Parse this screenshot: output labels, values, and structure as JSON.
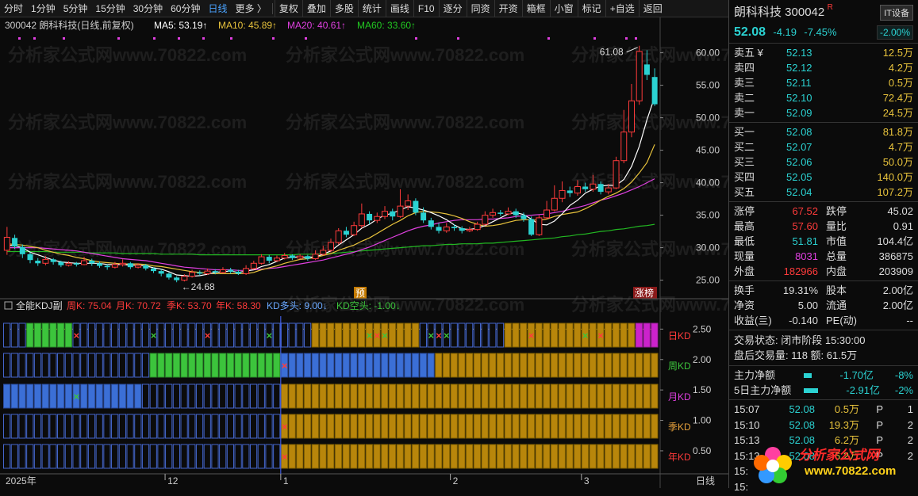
{
  "toolbar": {
    "periods": [
      "分时",
      "1分钟",
      "5分钟",
      "15分钟",
      "30分钟",
      "60分钟",
      "日线",
      "更多 〉"
    ],
    "active_period": "日线",
    "buttons": [
      "复权",
      "叠加",
      "多股",
      "统计",
      "画线",
      "F10",
      "逐分",
      "同资",
      "开资",
      "箱框",
      "小窗",
      "标记",
      "+自选",
      "返回"
    ]
  },
  "chart_header": {
    "stock": "300042 朗科科技(日线,前复权)",
    "ma5": "MA5: 53.19↑",
    "ma10": "MA10: 45.89↑",
    "ma20": "MA20: 40.61↑",
    "ma60": "MA60: 33.60↑"
  },
  "kdj_header": {
    "name": "全能KDJ副",
    "week": "周K: 75.04",
    "month": "月K: 70.72",
    "season": "季K: 53.70",
    "year": "年K: 58.30",
    "kd_long": "KD多头: 9.00↓",
    "kd_short": "KD空头: -1.00↓"
  },
  "kdj_rows": [
    "日KD",
    "周KD",
    "月KD",
    "季KD",
    "年KD"
  ],
  "chart_labels": {
    "high": "61.08",
    "low": "24.68",
    "yu": "预",
    "zhangbang": "涨榜"
  },
  "watermark": "分析家公式网www.70822.com",
  "price_axis": [
    "60.00",
    "55.00",
    "50.00",
    "45.00",
    "40.00",
    "35.00",
    "30.00",
    "25.00"
  ],
  "kdj_axis": [
    "2.50",
    "2.00",
    "1.50",
    "1.00",
    "0.50"
  ],
  "x_axis": {
    "labels": [
      "2025年",
      "12",
      "1",
      "2",
      "3"
    ],
    "period": "日线"
  },
  "colors": {
    "up": "#ff3b3b",
    "down": "#2bd2d2",
    "ma5": "#ffffff",
    "ma10": "#e8c33c",
    "ma20": "#e040e0",
    "ma60": "#22b822",
    "gold": "#b8860b",
    "blue": "#3b6fd6",
    "green": "#3cc43c"
  },
  "quote": {
    "name": "朗科科技 300042",
    "badge_r": "R",
    "sector": "IT设备",
    "price": "52.08",
    "change": "-4.19",
    "pct": "-7.45%",
    "sector_pct": "-2.00%"
  },
  "asks": [
    {
      "l": "卖五 ¥",
      "p": "52.13",
      "v": "12.5万"
    },
    {
      "l": "卖四",
      "p": "52.12",
      "v": "4.2万"
    },
    {
      "l": "卖三",
      "p": "52.11",
      "v": "0.5万"
    },
    {
      "l": "卖二",
      "p": "52.10",
      "v": "72.4万"
    },
    {
      "l": "卖一",
      "p": "52.09",
      "v": "24.5万"
    }
  ],
  "bids": [
    {
      "l": "买一",
      "p": "52.08",
      "v": "81.8万"
    },
    {
      "l": "买二",
      "p": "52.07",
      "v": "4.7万"
    },
    {
      "l": "买三",
      "p": "52.06",
      "v": "50.0万"
    },
    {
      "l": "买四",
      "p": "52.05",
      "v": "140.0万"
    },
    {
      "l": "买五",
      "p": "52.04",
      "v": "107.2万"
    }
  ],
  "stats1": [
    {
      "k": "涨停",
      "v": "67.52",
      "c": "red",
      "k2": "跌停",
      "v2": "45.02",
      "c2": "cyan"
    },
    {
      "k": "最高",
      "v": "57.60",
      "c": "red",
      "k2": "量比",
      "v2": "0.91",
      "c2": "cyan"
    },
    {
      "k": "最低",
      "v": "51.81",
      "c": "cyan",
      "k2": "市值",
      "v2": "104.4亿",
      "c2": "white"
    },
    {
      "k": "现量",
      "v": "8031",
      "c": "mag",
      "k2": "总量",
      "v2": "386875",
      "c2": "white"
    },
    {
      "k": "外盘",
      "v": "182966",
      "c": "red",
      "k2": "内盘",
      "v2": "203909",
      "c2": "cyan"
    }
  ],
  "stats2": [
    {
      "k": "换手",
      "v": "19.31%",
      "c": "white",
      "k2": "股本",
      "v2": "2.00亿",
      "c2": "white"
    },
    {
      "k": "净资",
      "v": "5.00",
      "c": "white",
      "k2": "流通",
      "v2": "2.00亿",
      "c2": "white"
    },
    {
      "k": "收益(亖)",
      "v": "-0.140",
      "c": "white",
      "k2": "PE(动)",
      "v2": "--",
      "c2": "white"
    }
  ],
  "trade": {
    "status": "交易状态: 闭市阶段 15:30:00",
    "after": "盘后交易量: 118  额: 61.5万"
  },
  "flow": [
    {
      "k": "主力净额",
      "v": "-1.70亿",
      "p": "-8%"
    },
    {
      "k": "5日主力净额",
      "v": "-2.91亿",
      "p": "-2%"
    }
  ],
  "ticks": [
    {
      "t": "15:07",
      "p": "52.08",
      "v": "0.5万",
      "s": "P",
      "n": "1"
    },
    {
      "t": "15:10",
      "p": "52.08",
      "v": "19.3万",
      "s": "P",
      "n": "2"
    },
    {
      "t": "15:13",
      "p": "52.08",
      "v": "6.2万",
      "s": "P",
      "n": "2"
    },
    {
      "t": "15:13",
      "p": "52.08",
      "v": "6.2万",
      "s": "P",
      "n": "2"
    },
    {
      "t": "15:",
      "p": "",
      "v": "",
      "s": "",
      "n": ""
    },
    {
      "t": "15:",
      "p": "",
      "v": "",
      "s": "",
      "n": ""
    }
  ],
  "logo": {
    "cn": "分析家公式网",
    "url": "www.70822.com"
  },
  "chart_data": {
    "type": "candlestick",
    "ylim": [
      23,
      63
    ],
    "candles": [
      {
        "o": 29.6,
        "c": 31.6,
        "h": 33.2,
        "l": 28.9
      },
      {
        "o": 31.5,
        "c": 30.2,
        "h": 32.0,
        "l": 29.8
      },
      {
        "o": 30.1,
        "c": 29.0,
        "h": 30.5,
        "l": 28.4
      },
      {
        "o": 29.0,
        "c": 28.1,
        "h": 29.3,
        "l": 27.6
      },
      {
        "o": 28.0,
        "c": 27.6,
        "h": 28.4,
        "l": 27.2
      },
      {
        "o": 27.6,
        "c": 28.2,
        "h": 28.7,
        "l": 27.3
      },
      {
        "o": 28.2,
        "c": 27.8,
        "h": 28.4,
        "l": 27.4
      },
      {
        "o": 27.8,
        "c": 27.3,
        "h": 28.0,
        "l": 27.0
      },
      {
        "o": 27.3,
        "c": 27.6,
        "h": 27.9,
        "l": 27.1
      },
      {
        "o": 27.6,
        "c": 27.4,
        "h": 27.8,
        "l": 27.1
      },
      {
        "o": 27.4,
        "c": 28.0,
        "h": 28.6,
        "l": 27.3
      },
      {
        "o": 28.0,
        "c": 27.6,
        "h": 28.3,
        "l": 27.2
      },
      {
        "o": 27.6,
        "c": 27.2,
        "h": 27.9,
        "l": 26.9
      },
      {
        "o": 27.2,
        "c": 27.0,
        "h": 27.5,
        "l": 26.6
      },
      {
        "o": 27.0,
        "c": 27.4,
        "h": 27.8,
        "l": 26.8
      },
      {
        "o": 27.4,
        "c": 27.6,
        "h": 28.2,
        "l": 27.1
      },
      {
        "o": 27.6,
        "c": 27.0,
        "h": 27.8,
        "l": 26.7
      },
      {
        "o": 27.0,
        "c": 27.3,
        "h": 27.6,
        "l": 26.8
      },
      {
        "o": 27.3,
        "c": 26.8,
        "h": 27.5,
        "l": 26.5
      },
      {
        "o": 26.8,
        "c": 26.4,
        "h": 27.0,
        "l": 26.1
      },
      {
        "o": 26.4,
        "c": 26.0,
        "h": 26.7,
        "l": 25.6
      },
      {
        "o": 26.0,
        "c": 25.4,
        "h": 26.2,
        "l": 25.1
      },
      {
        "o": 25.4,
        "c": 25.0,
        "h": 25.6,
        "l": 24.68
      },
      {
        "o": 25.0,
        "c": 25.6,
        "h": 25.9,
        "l": 24.8
      },
      {
        "o": 25.6,
        "c": 26.2,
        "h": 26.6,
        "l": 25.4
      },
      {
        "o": 26.2,
        "c": 26.0,
        "h": 26.5,
        "l": 25.7
      },
      {
        "o": 26.0,
        "c": 26.4,
        "h": 26.8,
        "l": 25.8
      },
      {
        "o": 26.4,
        "c": 26.2,
        "h": 26.7,
        "l": 25.9
      },
      {
        "o": 26.2,
        "c": 26.6,
        "h": 27.0,
        "l": 26.0
      },
      {
        "o": 26.6,
        "c": 26.3,
        "h": 26.9,
        "l": 26.0
      },
      {
        "o": 26.3,
        "c": 26.0,
        "h": 26.6,
        "l": 25.8
      },
      {
        "o": 26.0,
        "c": 26.8,
        "h": 27.3,
        "l": 25.8
      },
      {
        "o": 26.8,
        "c": 27.6,
        "h": 28.0,
        "l": 26.6
      },
      {
        "o": 27.6,
        "c": 28.6,
        "h": 29.0,
        "l": 27.4
      },
      {
        "o": 28.6,
        "c": 28.0,
        "h": 28.9,
        "l": 27.6
      },
      {
        "o": 28.0,
        "c": 28.4,
        "h": 28.8,
        "l": 27.8
      },
      {
        "o": 28.4,
        "c": 28.8,
        "h": 29.2,
        "l": 28.2
      },
      {
        "o": 28.8,
        "c": 28.4,
        "h": 29.0,
        "l": 28.1
      },
      {
        "o": 28.4,
        "c": 28.7,
        "h": 29.0,
        "l": 28.2
      },
      {
        "o": 28.7,
        "c": 28.3,
        "h": 28.9,
        "l": 28.0
      },
      {
        "o": 28.3,
        "c": 29.0,
        "h": 29.6,
        "l": 28.1
      },
      {
        "o": 29.0,
        "c": 29.6,
        "h": 30.3,
        "l": 28.8
      },
      {
        "o": 29.6,
        "c": 30.8,
        "h": 31.4,
        "l": 29.3
      },
      {
        "o": 30.8,
        "c": 32.6,
        "h": 33.0,
        "l": 30.5
      },
      {
        "o": 32.6,
        "c": 32.0,
        "h": 33.2,
        "l": 31.6
      },
      {
        "o": 32.0,
        "c": 33.4,
        "h": 34.0,
        "l": 31.8
      },
      {
        "o": 33.4,
        "c": 35.2,
        "h": 36.8,
        "l": 33.0
      },
      {
        "o": 35.2,
        "c": 34.2,
        "h": 35.6,
        "l": 33.6
      },
      {
        "o": 34.2,
        "c": 34.8,
        "h": 35.4,
        "l": 33.8
      },
      {
        "o": 34.8,
        "c": 35.6,
        "h": 36.4,
        "l": 34.4
      },
      {
        "o": 35.6,
        "c": 34.8,
        "h": 36.0,
        "l": 34.2
      },
      {
        "o": 34.8,
        "c": 36.4,
        "h": 39.0,
        "l": 34.6
      },
      {
        "o": 36.4,
        "c": 37.2,
        "h": 38.2,
        "l": 35.8
      },
      {
        "o": 37.2,
        "c": 35.4,
        "h": 37.6,
        "l": 35.0
      },
      {
        "o": 35.4,
        "c": 34.2,
        "h": 36.2,
        "l": 33.8
      },
      {
        "o": 34.2,
        "c": 33.2,
        "h": 34.6,
        "l": 32.8
      },
      {
        "o": 33.2,
        "c": 32.6,
        "h": 33.8,
        "l": 32.2
      },
      {
        "o": 32.6,
        "c": 33.2,
        "h": 33.8,
        "l": 32.3
      },
      {
        "o": 33.2,
        "c": 33.0,
        "h": 33.6,
        "l": 32.6
      },
      {
        "o": 33.0,
        "c": 32.6,
        "h": 33.3,
        "l": 32.2
      },
      {
        "o": 32.6,
        "c": 32.8,
        "h": 33.2,
        "l": 32.4
      },
      {
        "o": 32.8,
        "c": 33.6,
        "h": 34.0,
        "l": 32.6
      },
      {
        "o": 33.6,
        "c": 35.0,
        "h": 35.6,
        "l": 33.4
      },
      {
        "o": 35.0,
        "c": 35.4,
        "h": 36.0,
        "l": 34.6
      },
      {
        "o": 35.4,
        "c": 35.2,
        "h": 35.8,
        "l": 34.9
      },
      {
        "o": 35.2,
        "c": 35.6,
        "h": 36.2,
        "l": 35.0
      },
      {
        "o": 35.6,
        "c": 35.0,
        "h": 36.0,
        "l": 34.6
      },
      {
        "o": 35.0,
        "c": 34.4,
        "h": 35.4,
        "l": 34.0
      },
      {
        "o": 34.4,
        "c": 32.0,
        "h": 34.8,
        "l": 31.8
      },
      {
        "o": 32.0,
        "c": 34.6,
        "h": 35.0,
        "l": 31.8
      },
      {
        "o": 34.6,
        "c": 35.8,
        "h": 37.2,
        "l": 34.4
      },
      {
        "o": 35.8,
        "c": 37.6,
        "h": 39.6,
        "l": 35.6
      },
      {
        "o": 37.6,
        "c": 38.8,
        "h": 40.2,
        "l": 37.0
      },
      {
        "o": 38.8,
        "c": 38.4,
        "h": 39.4,
        "l": 37.8
      },
      {
        "o": 38.4,
        "c": 39.4,
        "h": 40.4,
        "l": 38.0
      },
      {
        "o": 39.4,
        "c": 39.0,
        "h": 40.0,
        "l": 38.6
      },
      {
        "o": 39.0,
        "c": 39.8,
        "h": 41.2,
        "l": 38.6
      },
      {
        "o": 39.8,
        "c": 38.6,
        "h": 40.2,
        "l": 38.2
      },
      {
        "o": 38.6,
        "c": 39.2,
        "h": 39.8,
        "l": 38.2
      },
      {
        "o": 39.2,
        "c": 43.4,
        "h": 44.0,
        "l": 39.0
      },
      {
        "o": 43.4,
        "c": 47.8,
        "h": 51.2,
        "l": 43.0
      },
      {
        "o": 47.8,
        "c": 52.6,
        "h": 55.2,
        "l": 47.0
      },
      {
        "o": 52.6,
        "c": 60.2,
        "h": 61.08,
        "l": 52.0
      },
      {
        "o": 58.2,
        "c": 56.6,
        "h": 60.4,
        "l": 55.8
      },
      {
        "o": 56.27,
        "c": 52.08,
        "h": 57.6,
        "l": 51.81
      }
    ],
    "ma5": [
      30.4,
      30.3,
      30.0,
      29.3,
      28.9,
      28.5,
      28.1,
      27.8,
      27.7,
      27.6,
      27.6,
      27.6,
      27.6,
      27.4,
      27.4,
      27.4,
      27.3,
      27.3,
      27.2,
      26.9,
      26.7,
      26.3,
      25.8,
      25.7,
      25.6,
      25.7,
      25.9,
      26.2,
      26.3,
      26.4,
      26.2,
      26.4,
      26.6,
      27.1,
      27.4,
      27.9,
      28.4,
      28.5,
      28.6,
      28.5,
      28.6,
      29.0,
      29.5,
      30.4,
      31.2,
      32.0,
      33.0,
      33.6,
      34.4,
      35.0,
      35.3,
      35.8,
      36.3,
      36.1,
      35.8,
      35.4,
      34.9,
      34.3,
      33.5,
      32.9,
      32.8,
      33.0,
      33.4,
      34.0,
      34.6,
      35.2,
      35.4,
      35.1,
      34.4,
      33.6,
      33.5,
      34.1,
      35.2,
      36.5,
      37.3,
      38.4,
      39.0,
      39.5,
      39.6,
      39.6,
      40.5,
      42.5,
      45.6,
      49.7,
      53.19
    ],
    "ma10": [
      30.6,
      30.5,
      30.4,
      30.2,
      30.0,
      29.6,
      29.3,
      29.0,
      28.8,
      28.5,
      28.3,
      28.0,
      27.8,
      27.7,
      27.6,
      27.5,
      27.5,
      27.5,
      27.4,
      27.2,
      27.1,
      26.9,
      26.7,
      26.5,
      26.3,
      26.2,
      26.1,
      26.0,
      26.0,
      26.0,
      26.0,
      26.0,
      26.2,
      26.6,
      26.9,
      27.2,
      27.6,
      27.9,
      28.2,
      28.3,
      28.5,
      28.8,
      29.1,
      29.6,
      30.0,
      30.4,
      31.0,
      31.5,
      32.2,
      32.9,
      33.6,
      34.2,
      34.9,
      35.4,
      35.6,
      35.5,
      35.4,
      35.2,
      34.9,
      34.5,
      34.0,
      33.6,
      33.3,
      33.4,
      33.6,
      33.9,
      34.2,
      34.3,
      34.3,
      34.2,
      34.4,
      34.8,
      35.1,
      35.3,
      35.5,
      36.0,
      36.6,
      37.3,
      37.9,
      38.4,
      39.1,
      40.1,
      41.5,
      43.1,
      45.89
    ],
    "ma20": [
      30.0,
      30.0,
      30.0,
      30.0,
      30.0,
      29.9,
      29.8,
      29.7,
      29.6,
      29.5,
      29.3,
      29.1,
      28.9,
      28.7,
      28.5,
      28.3,
      28.2,
      28.1,
      28.0,
      27.8,
      27.6,
      27.4,
      27.2,
      27.0,
      26.9,
      26.8,
      26.7,
      26.6,
      26.6,
      26.6,
      26.5,
      26.5,
      26.6,
      26.7,
      26.8,
      26.9,
      27.1,
      27.3,
      27.5,
      27.7,
      27.9,
      28.1,
      28.4,
      28.7,
      29.0,
      29.3,
      29.7,
      30.1,
      30.6,
      31.1,
      31.6,
      32.1,
      32.6,
      33.0,
      33.3,
      33.5,
      33.8,
      34.0,
      34.2,
      34.3,
      34.3,
      34.3,
      34.4,
      34.4,
      34.5,
      34.6,
      34.8,
      34.9,
      35.0,
      35.1,
      35.2,
      35.4,
      35.6,
      35.9,
      36.2,
      36.5,
      36.9,
      37.3,
      37.6,
      38.0,
      38.4,
      38.9,
      39.4,
      40.0,
      40.61
    ],
    "ma60": [
      29.4,
      29.4,
      29.4,
      29.4,
      29.4,
      29.4,
      29.3,
      29.3,
      29.3,
      29.3,
      29.3,
      29.2,
      29.2,
      29.2,
      29.2,
      29.1,
      29.1,
      29.1,
      29.1,
      29.1,
      29.0,
      29.0,
      29.0,
      29.0,
      29.0,
      28.9,
      28.9,
      28.9,
      28.9,
      28.9,
      28.9,
      28.9,
      28.9,
      28.9,
      28.9,
      28.9,
      28.9,
      28.9,
      29.0,
      29.0,
      29.0,
      29.1,
      29.1,
      29.2,
      29.3,
      29.4,
      29.5,
      29.6,
      29.7,
      29.8,
      29.9,
      30.0,
      30.1,
      30.2,
      30.3,
      30.3,
      30.4,
      30.5,
      30.5,
      30.6,
      30.6,
      30.6,
      30.7,
      30.7,
      30.8,
      30.9,
      31.0,
      31.1,
      31.2,
      31.3,
      31.4,
      31.5,
      31.7,
      31.8,
      32.0,
      32.1,
      32.3,
      32.5,
      32.6,
      32.8,
      32.9,
      33.1,
      33.3,
      33.4,
      33.6
    ],
    "kdj": {
      "day": "BBBGGGGGGBBBBBBBBBBBBBBBBBBBBBBBBBBBBBBBOOOOOOOOOOOOOOBBBBBBBBBBBOOOOOOOOOOOOOOOOOMMMMMO",
      "week": "BBBBBBBBBBBBBBBBBBBGGGGGGGGGGGGGGGGGGGGGGGGGGGGGGGGGGGGGLLLLLLLLLLLLLLLLLLLLLLLLLLLLLLLLL",
      "month": "LLLLLLLLLLLLLLLLLLBBBBBBBBBBBBBBBBBBBBBBBBBBBBBBBBBBBBBBBBBBBBBBBBBBBBBBBBBBBBBBBBBBBBBBB",
      "season": "BBBBBBBBBBBBBBBBBBBBBBBBBBBBBBBBBBBBBBBBBBBBBBBBBBBBBBBBBBBBBBBBBBBBBBBBBBBBBBBBBBBBBBBBB",
      "year": "BBBBBBBBBBBBBBBBBBBBBBBBBBBBBBBBBBBBBBBBBBBBBBBBBBBBBBBBBBBBBBBBBBBBBBBBBBBBBBBBBBBBBBBBB"
    }
  }
}
